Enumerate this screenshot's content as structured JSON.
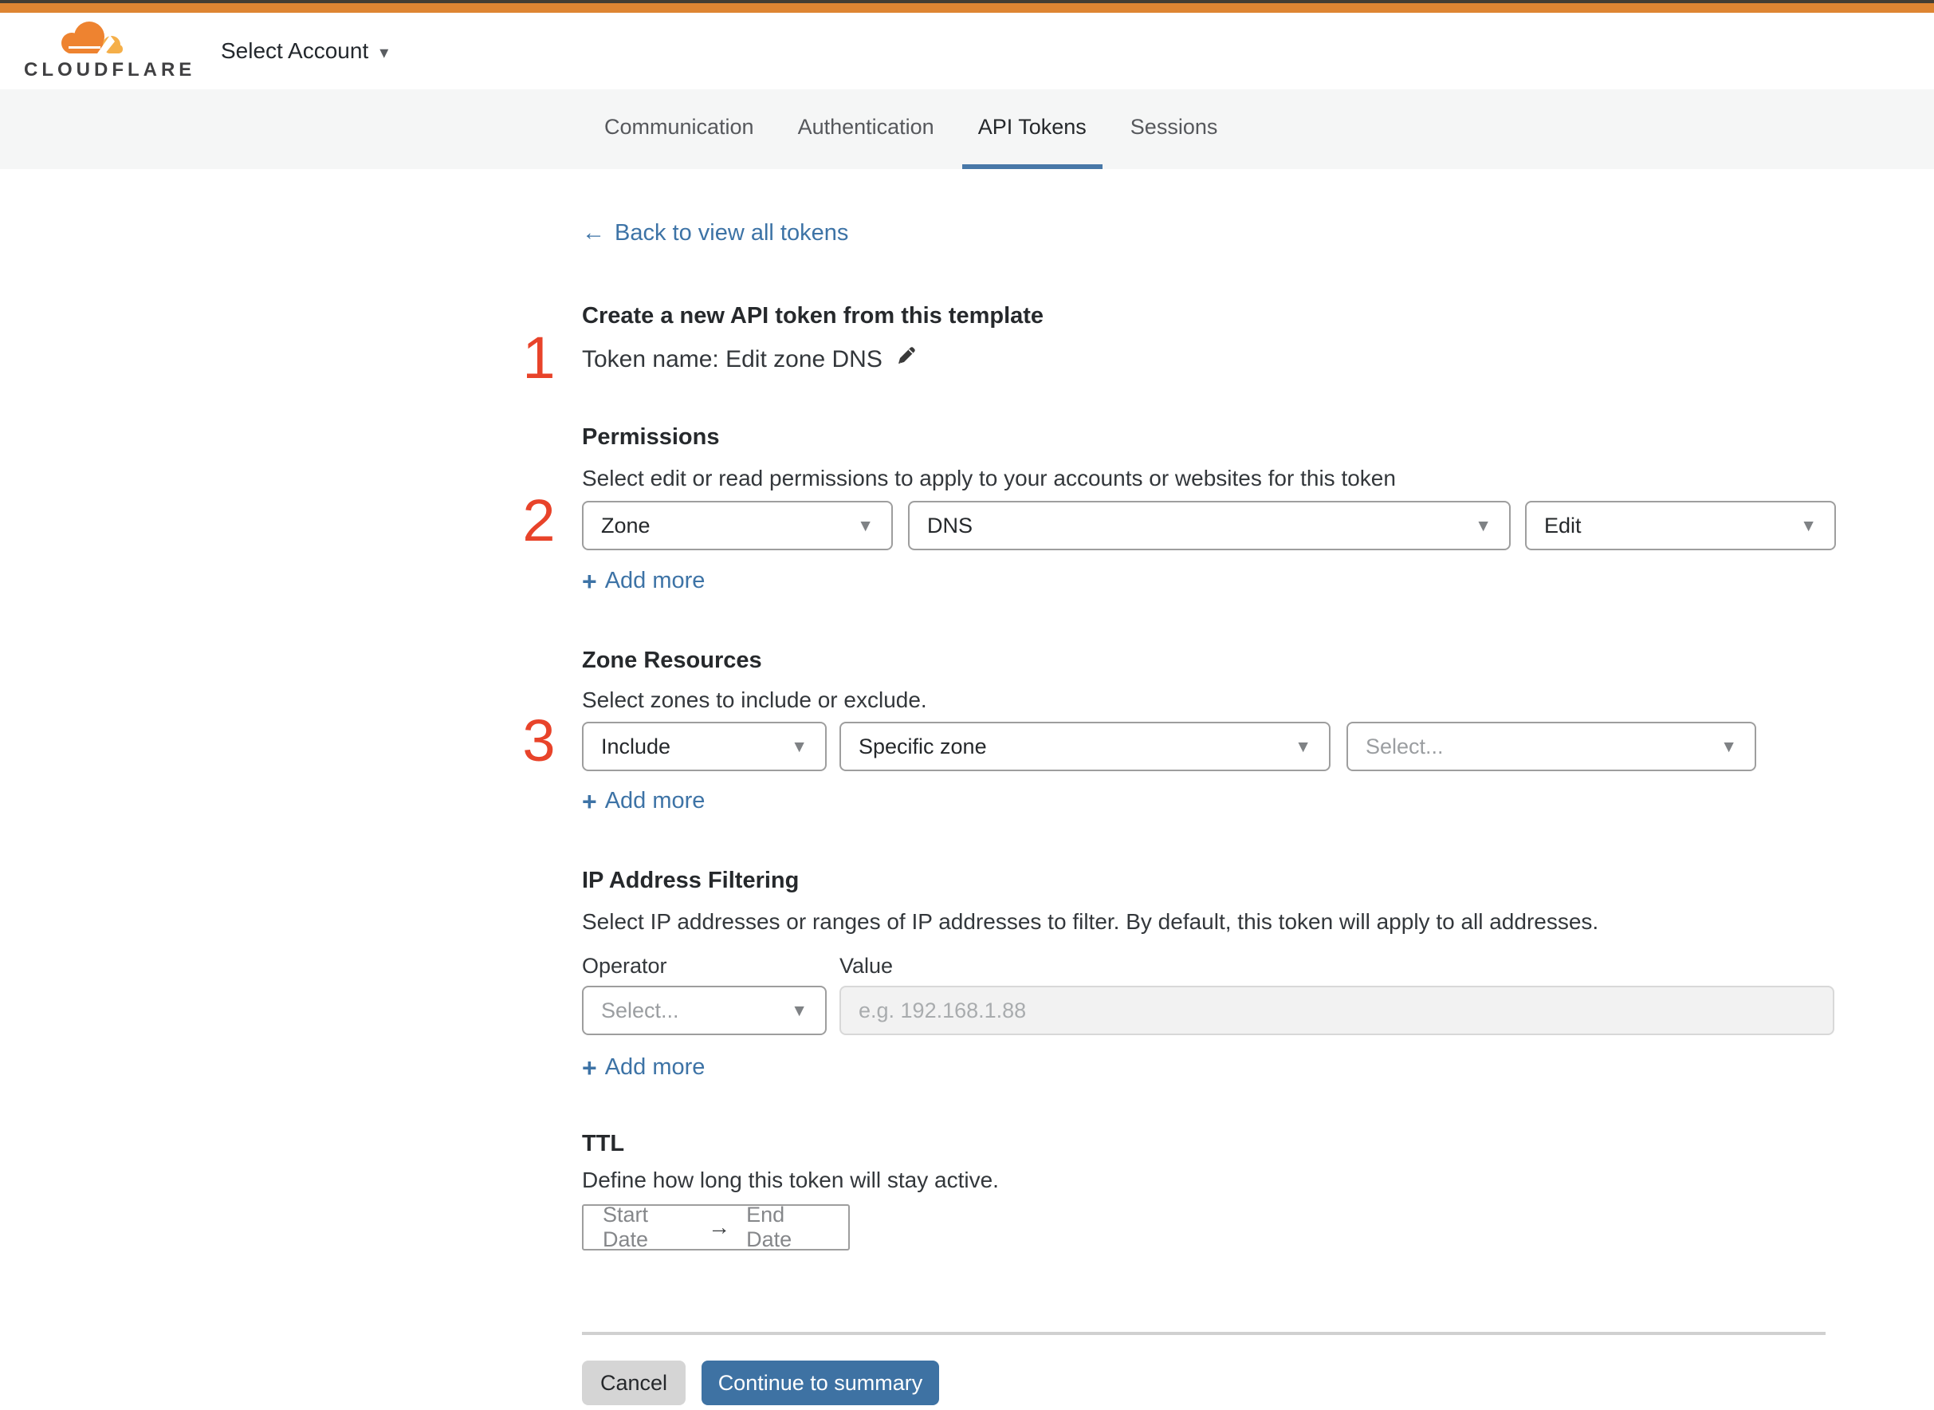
{
  "colors": {
    "top_bar_orange": "#de8532",
    "top_bar_dark": "#433d33",
    "link_blue": "#3d73a6",
    "tab_underline_blue": "#4878a8",
    "annotation_red": "#e8432a",
    "primary_button_blue": "#3e72a3"
  },
  "icons": {
    "caret_down": "▾",
    "dropdown_caret": "▼",
    "arrow_left": "←",
    "arrow_right": "→",
    "plus": "+"
  },
  "header": {
    "logo_text": "CLOUDFLARE",
    "account_selector_label": "Select Account"
  },
  "tabs": {
    "items": [
      {
        "label": "Communication",
        "active": false
      },
      {
        "label": "Authentication",
        "active": false
      },
      {
        "label": "API Tokens",
        "active": true
      },
      {
        "label": "Sessions",
        "active": false
      }
    ]
  },
  "back_link": {
    "label": "Back to view all tokens"
  },
  "annotations": {
    "step1": "1",
    "step2": "2",
    "step3": "3"
  },
  "token_template": {
    "heading": "Create a new API token from this template",
    "token_name_line": "Token name: Edit zone DNS"
  },
  "permissions": {
    "heading": "Permissions",
    "description": "Select edit or read permissions to apply to your accounts or websites for this token",
    "scope_value": "Zone",
    "resource_value": "DNS",
    "access_value": "Edit",
    "add_more_label": "Add more"
  },
  "zone_resources": {
    "heading": "Zone Resources",
    "description": "Select zones to include or exclude.",
    "mode_value": "Include",
    "type_value": "Specific zone",
    "zone_placeholder": "Select...",
    "add_more_label": "Add more"
  },
  "ip_filtering": {
    "heading": "IP Address Filtering",
    "description": "Select IP addresses or ranges of IP addresses to filter. By default, this token will apply to all addresses.",
    "operator_label": "Operator",
    "value_label": "Value",
    "operator_placeholder": "Select...",
    "value_placeholder": "e.g. 192.168.1.88",
    "add_more_label": "Add more"
  },
  "ttl": {
    "heading": "TTL",
    "description": "Define how long this token will stay active.",
    "start_date_placeholder": "Start Date",
    "end_date_placeholder": "End Date"
  },
  "footer": {
    "cancel_label": "Cancel",
    "continue_label": "Continue to summary"
  }
}
